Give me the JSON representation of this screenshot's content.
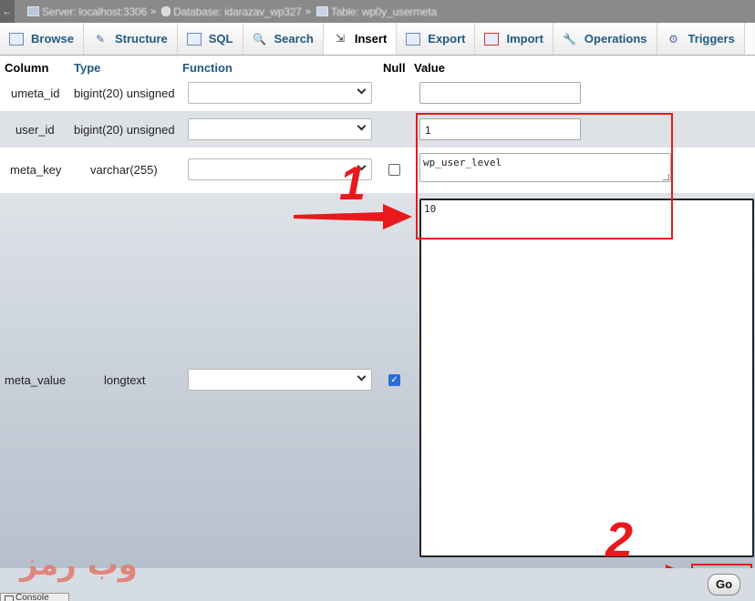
{
  "breadcrumb": {
    "server": "Server: localhost:3306",
    "separator": "»",
    "database": "Database: idarazav_wp327",
    "table": "Table: wp0y_usermeta"
  },
  "tabs": [
    {
      "label": "Browse",
      "icon": "table-icon"
    },
    {
      "label": "Structure",
      "icon": "structure-icon"
    },
    {
      "label": "SQL",
      "icon": "sql-icon"
    },
    {
      "label": "Search",
      "icon": "search-icon"
    },
    {
      "label": "Insert",
      "icon": "insert-icon",
      "active": true
    },
    {
      "label": "Export",
      "icon": "export-icon"
    },
    {
      "label": "Import",
      "icon": "import-icon"
    },
    {
      "label": "Operations",
      "icon": "wrench-icon"
    },
    {
      "label": "Triggers",
      "icon": "triggers-icon"
    }
  ],
  "headers": {
    "column": "Column",
    "type": "Type",
    "function": "Function",
    "null": "Null",
    "value": "Value"
  },
  "rows": [
    {
      "column": "umeta_id",
      "type": "bigint(20) unsigned",
      "function": "",
      "null": null,
      "value": ""
    },
    {
      "column": "user_id",
      "type": "bigint(20) unsigned",
      "function": "",
      "null": null,
      "value": "1"
    },
    {
      "column": "meta_key",
      "type": "varchar(255)",
      "function": "",
      "null": false,
      "value": "wp_user_level"
    },
    {
      "column": "meta_value",
      "type": "longtext",
      "function": "",
      "null": true,
      "value": "10"
    }
  ],
  "annotations": {
    "step1": "1",
    "step2": "2",
    "color": "#e8191d"
  },
  "go_button": "Go",
  "console": "Console",
  "watermark": "وب رمز",
  "colors": {
    "link": "#235a81",
    "breadcrumb_bg": "#8a8a8a",
    "checkbox_checked": "#2f6bd8"
  }
}
